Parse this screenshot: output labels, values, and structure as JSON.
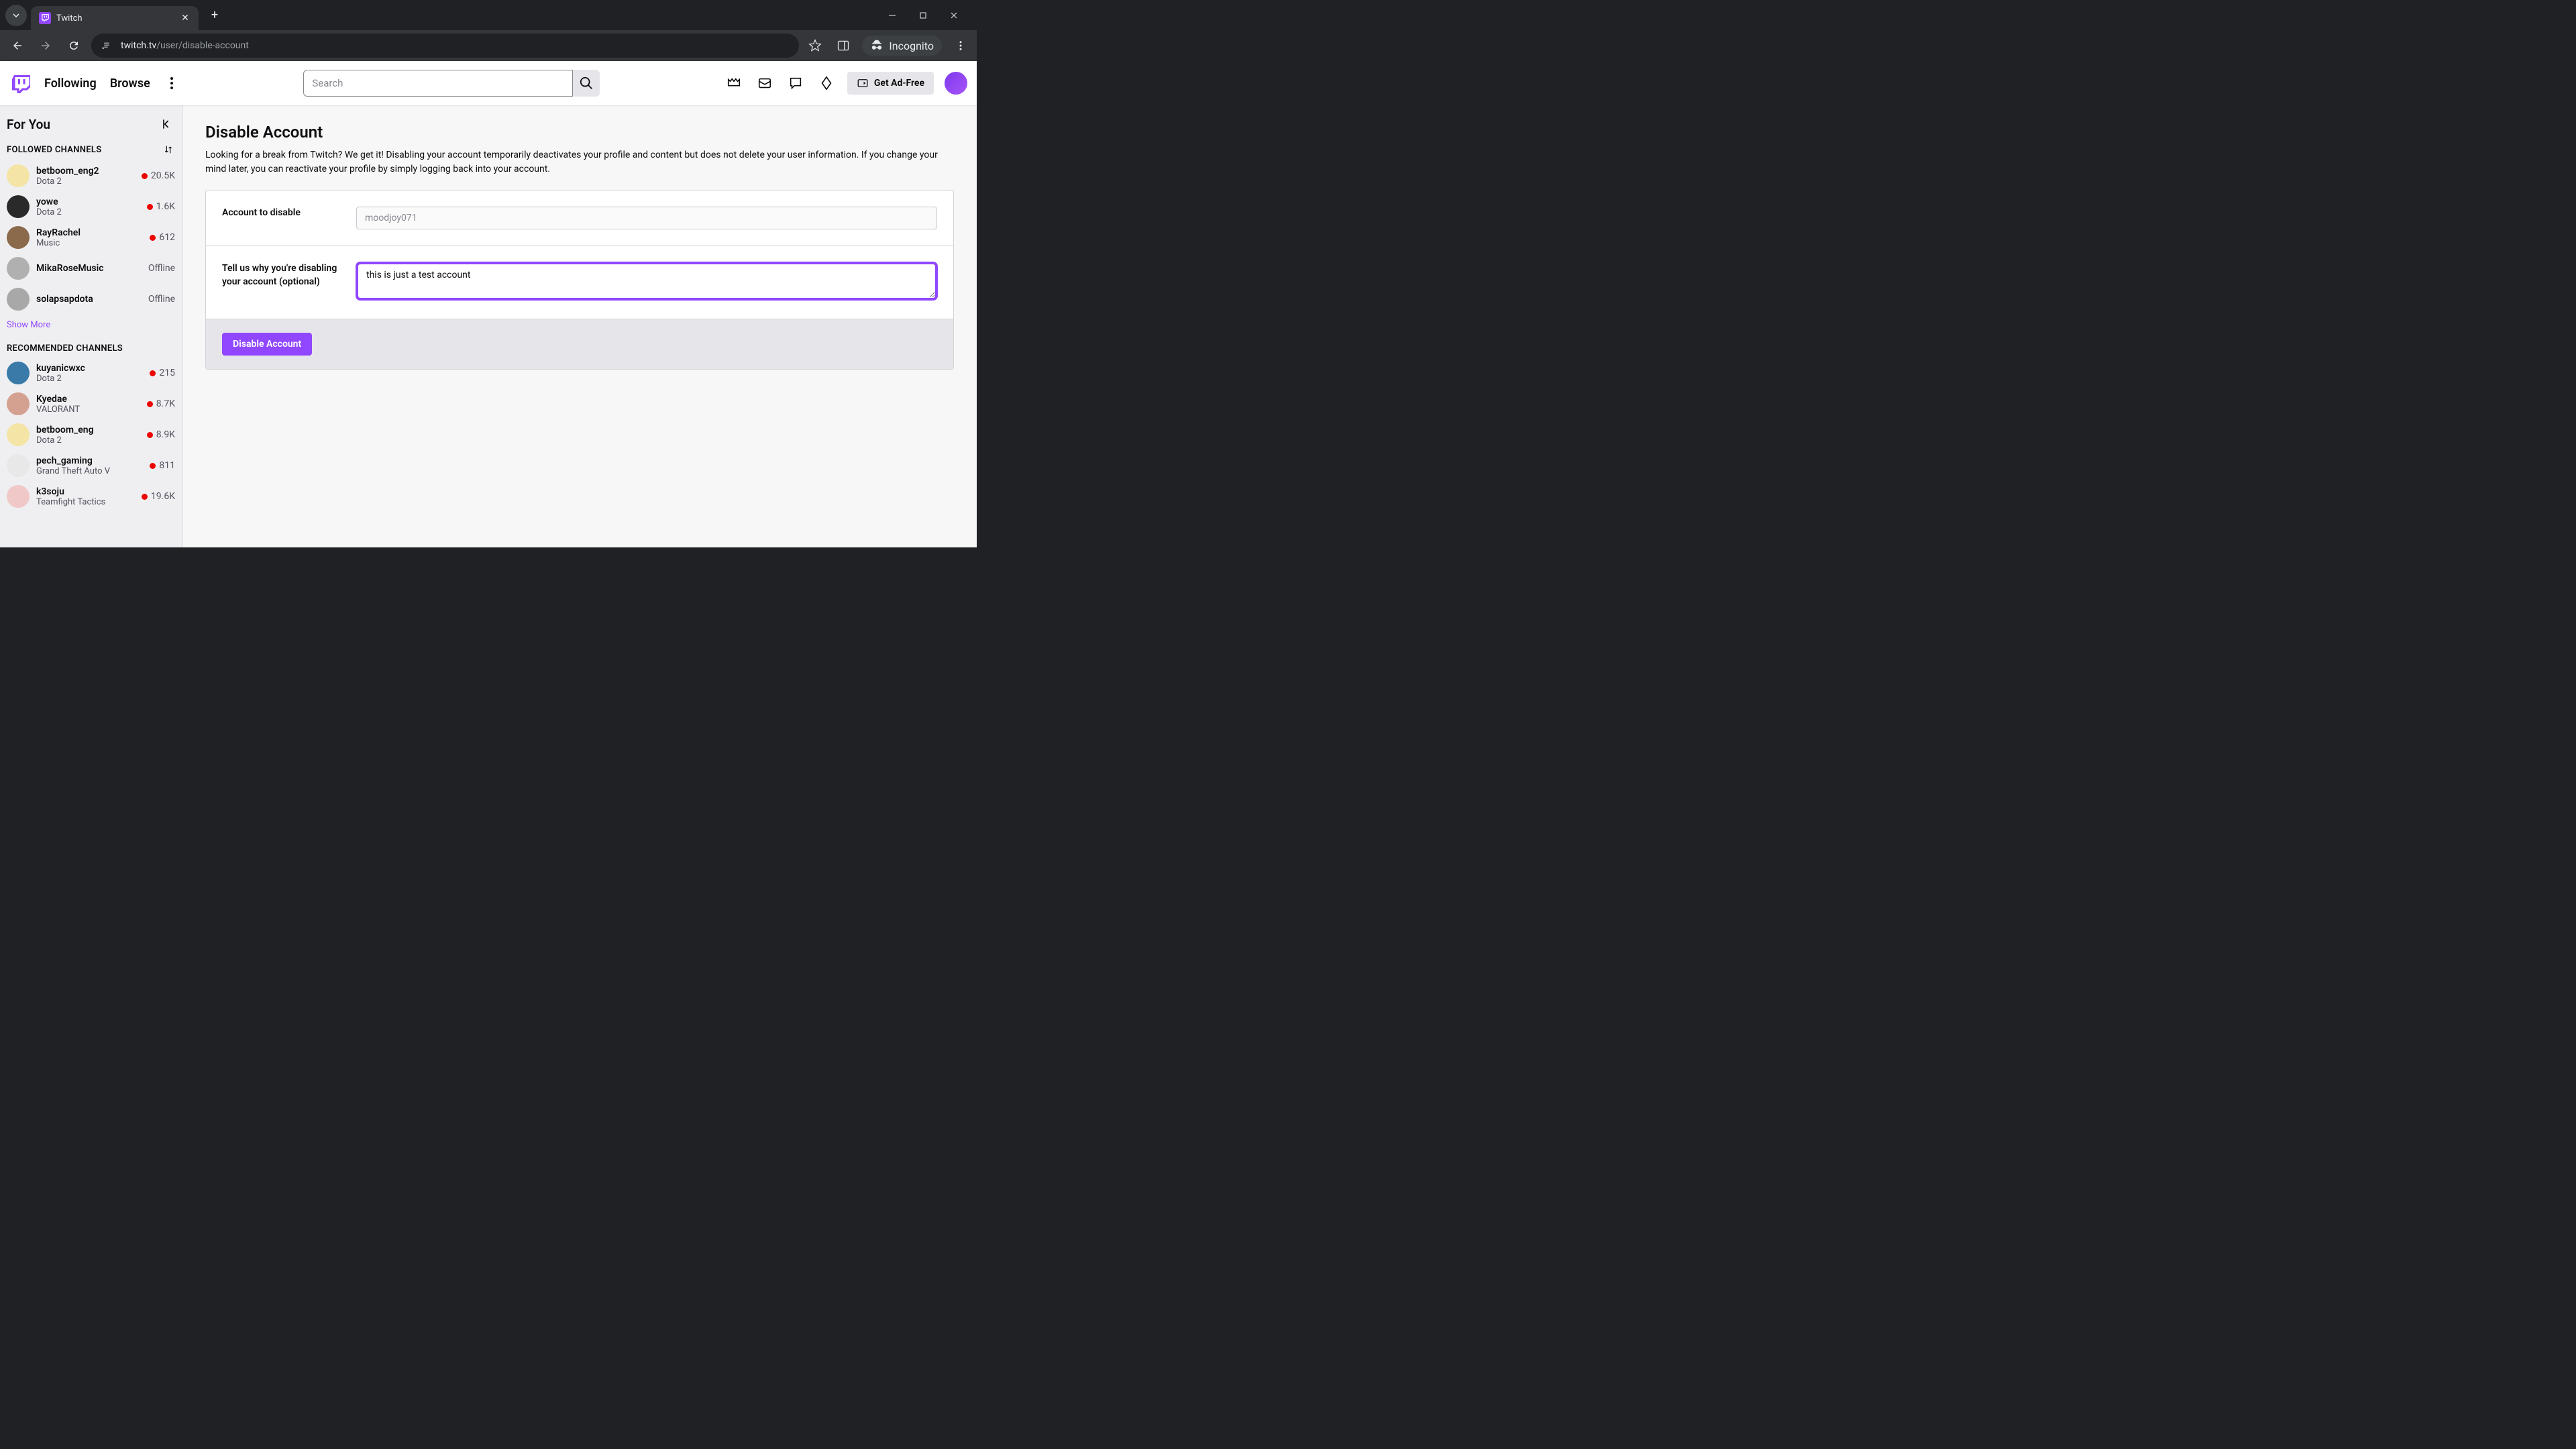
{
  "browser": {
    "tab_title": "Twitch",
    "url_domain": "twitch.tv",
    "url_path": "/user/disable-account",
    "incognito_label": "Incognito"
  },
  "header": {
    "nav_following": "Following",
    "nav_browse": "Browse",
    "search_placeholder": "Search",
    "get_ad_free": "Get Ad-Free"
  },
  "sidebar": {
    "title": "For You",
    "followed_header": "FOLLOWED CHANNELS",
    "recommended_header": "RECOMMENDED CHANNELS",
    "show_more": "Show More",
    "followed": [
      {
        "name": "betboom_eng2",
        "game": "Dota 2",
        "viewers": "20.5K",
        "live": true,
        "avatar": "#f4e4a6"
      },
      {
        "name": "yowe",
        "game": "Dota 2",
        "viewers": "1.6K",
        "live": true,
        "avatar": "#2a2a2a"
      },
      {
        "name": "RayRachel",
        "game": "Music",
        "viewers": "612",
        "live": true,
        "avatar": "#8a6a4a"
      },
      {
        "name": "MikaRoseMusic",
        "game": "",
        "viewers": "Offline",
        "live": false,
        "avatar": "#b0b0b0"
      },
      {
        "name": "solapsapdota",
        "game": "",
        "viewers": "Offline",
        "live": false,
        "avatar": "#a8a8a8"
      }
    ],
    "recommended": [
      {
        "name": "kuyanicwxc",
        "game": "Dota 2",
        "viewers": "215",
        "live": true,
        "avatar": "#3a7aa8"
      },
      {
        "name": "Kyedae",
        "game": "VALORANT",
        "viewers": "8.7K",
        "live": true,
        "avatar": "#d4a090"
      },
      {
        "name": "betboom_eng",
        "game": "Dota 2",
        "viewers": "8.9K",
        "live": true,
        "avatar": "#f4e4a6"
      },
      {
        "name": "pech_gaming",
        "game": "Grand Theft Auto V",
        "viewers": "811",
        "live": true,
        "avatar": "#e8e8e8"
      },
      {
        "name": "k3soju",
        "game": "Teamfight Tactics",
        "viewers": "19.6K",
        "live": true,
        "avatar": "#f0c8c8"
      }
    ]
  },
  "page": {
    "title": "Disable Account",
    "description": "Looking for a break from Twitch? We get it! Disabling your account temporarily deactivates your profile and content but does not delete your user information. If you change your mind later, you can reactivate your profile by simply logging back into your account.",
    "account_label": "Account to disable",
    "account_value": "moodjoy071",
    "reason_label": "Tell us why you're disabling your account (optional)",
    "reason_value": "this is just a test account",
    "disable_button": "Disable Account"
  }
}
